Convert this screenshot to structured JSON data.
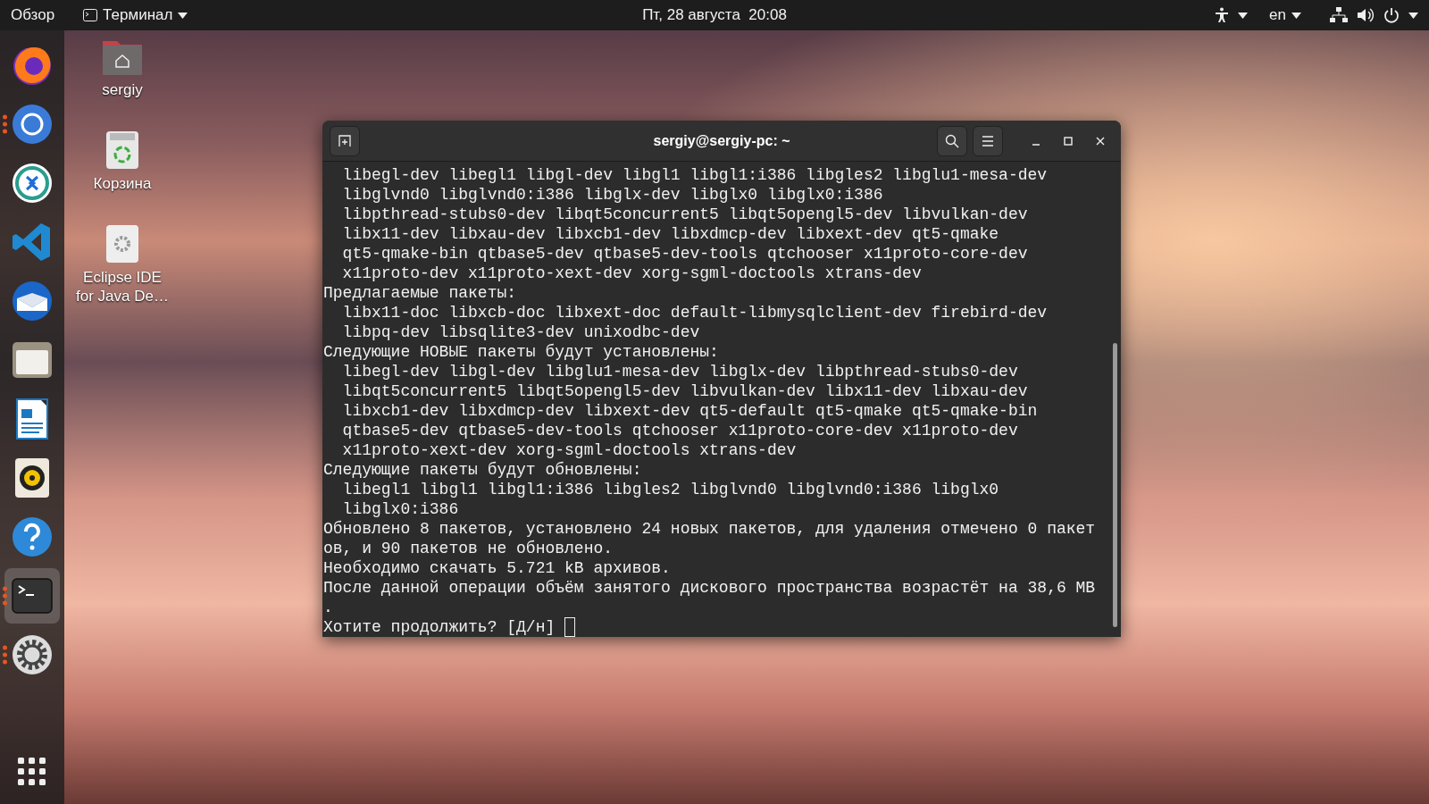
{
  "top_bar": {
    "activities": "Обзор",
    "app_menu": "Терминал",
    "clock": "Пт, 28 августа  20:08",
    "language": "en"
  },
  "dock": {
    "items": [
      {
        "kind": "fox",
        "running": false,
        "selected": false
      },
      {
        "kind": "ring",
        "running": true,
        "selected": false
      },
      {
        "kind": "remote",
        "running": false,
        "selected": false
      },
      {
        "kind": "code",
        "running": false,
        "selected": false
      },
      {
        "kind": "mail",
        "running": false,
        "selected": false
      },
      {
        "kind": "files",
        "running": false,
        "selected": false
      },
      {
        "kind": "writer",
        "running": false,
        "selected": false
      },
      {
        "kind": "audio",
        "running": false,
        "selected": false
      },
      {
        "kind": "help",
        "running": false,
        "selected": false
      },
      {
        "kind": "terminal",
        "running": true,
        "selected": true
      },
      {
        "kind": "settings",
        "running": true,
        "selected": false
      }
    ]
  },
  "desktop_icons": [
    {
      "kind": "home",
      "label": "sergiy"
    },
    {
      "kind": "trash",
      "label": "Корзина"
    },
    {
      "kind": "app",
      "label": "Eclipse IDE for Java De…"
    }
  ],
  "terminal": {
    "title": "sergiy@sergiy-pc: ~",
    "lines": [
      "  libegl-dev libegl1 libgl-dev libgl1 libgl1:i386 libgles2 libglu1-mesa-dev",
      "  libglvnd0 libglvnd0:i386 libglx-dev libglx0 libglx0:i386",
      "  libpthread-stubs0-dev libqt5concurrent5 libqt5opengl5-dev libvulkan-dev",
      "  libx11-dev libxau-dev libxcb1-dev libxdmcp-dev libxext-dev qt5-qmake",
      "  qt5-qmake-bin qtbase5-dev qtbase5-dev-tools qtchooser x11proto-core-dev",
      "  x11proto-dev x11proto-xext-dev xorg-sgml-doctools xtrans-dev",
      "Предлагаемые пакеты:",
      "  libx11-doc libxcb-doc libxext-doc default-libmysqlclient-dev firebird-dev",
      "  libpq-dev libsqlite3-dev unixodbc-dev",
      "Следующие НОВЫЕ пакеты будут установлены:",
      "  libegl-dev libgl-dev libglu1-mesa-dev libglx-dev libpthread-stubs0-dev",
      "  libqt5concurrent5 libqt5opengl5-dev libvulkan-dev libx11-dev libxau-dev",
      "  libxcb1-dev libxdmcp-dev libxext-dev qt5-default qt5-qmake qt5-qmake-bin",
      "  qtbase5-dev qtbase5-dev-tools qtchooser x11proto-core-dev x11proto-dev",
      "  x11proto-xext-dev xorg-sgml-doctools xtrans-dev",
      "Следующие пакеты будут обновлены:",
      "  libegl1 libgl1 libgl1:i386 libgles2 libglvnd0 libglvnd0:i386 libglx0",
      "  libglx0:i386",
      "Обновлено 8 пакетов, установлено 24 новых пакетов, для удаления отмечено 0 пакет",
      "ов, и 90 пакетов не обновлено.",
      "Необходимо скачать 5.721 kB архивов.",
      "После данной операции объём занятого дискового пространства возрастёт на 38,6 MB",
      "."
    ],
    "prompt": "Хотите продолжить? [Д/н]"
  }
}
